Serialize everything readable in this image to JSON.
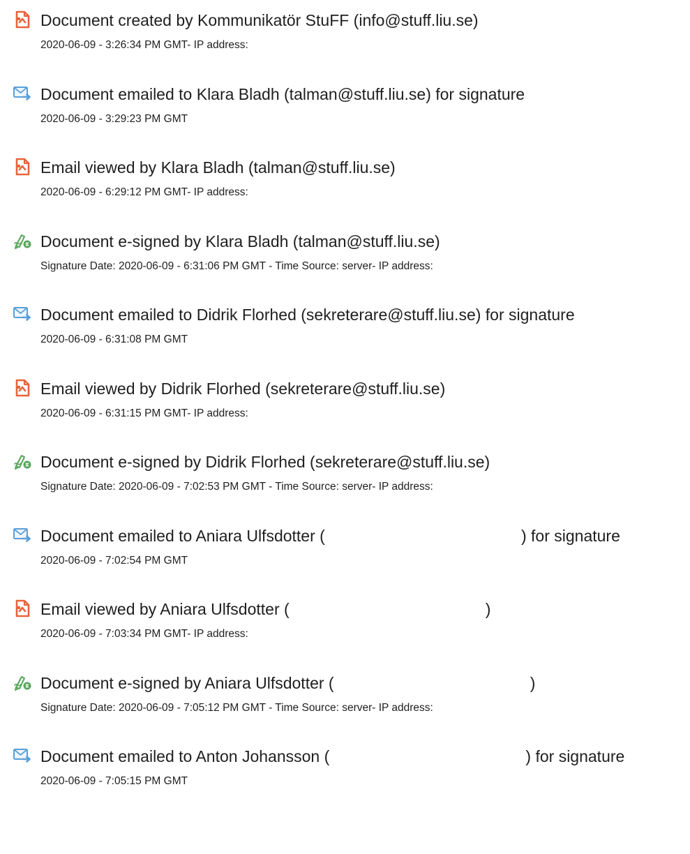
{
  "colors": {
    "doc_icon": "#e8643c",
    "mail_icon": "#5a9fd8",
    "sign_icon": "#58a55c",
    "text": "#1f1f1f"
  },
  "events": [
    {
      "icon": "document-icon",
      "title": "Document created by Kommunikatör StuFF (info@stuff.liu.se)",
      "detail": "2020-06-09 - 3:26:34 PM GMT- IP address:"
    },
    {
      "icon": "email-sent-icon",
      "title": "Document emailed to Klara Bladh (talman@stuff.liu.se) for signature",
      "detail": "2020-06-09 - 3:29:23 PM GMT"
    },
    {
      "icon": "document-icon",
      "title": "Email viewed by Klara Bladh (talman@stuff.liu.se)",
      "detail": "2020-06-09 - 6:29:12 PM GMT- IP address:"
    },
    {
      "icon": "esign-pen-icon",
      "title": "Document e-signed by Klara Bladh (talman@stuff.liu.se)",
      "detail": "Signature Date: 2020-06-09 - 6:31:06 PM GMT - Time Source: server- IP address:"
    },
    {
      "icon": "email-sent-icon",
      "title": "Document emailed to Didrik Florhed (sekreterare@stuff.liu.se) for signature",
      "detail": "2020-06-09 - 6:31:08 PM GMT"
    },
    {
      "icon": "document-icon",
      "title": "Email viewed by Didrik Florhed (sekreterare@stuff.liu.se)",
      "detail": "2020-06-09 - 6:31:15 PM GMT- IP address:"
    },
    {
      "icon": "esign-pen-icon",
      "title": "Document e-signed by Didrik Florhed (sekreterare@stuff.liu.se)",
      "detail": "Signature Date: 2020-06-09 - 7:02:53 PM GMT - Time Source: server- IP address:"
    },
    {
      "icon": "email-sent-icon",
      "title": "Document emailed to Aniara Ulfsdotter (                                            ) for signature",
      "detail": "2020-06-09 - 7:02:54 PM GMT"
    },
    {
      "icon": "document-icon",
      "title": "Email viewed by Aniara Ulfsdotter (                                            )",
      "detail": "2020-06-09 - 7:03:34 PM GMT- IP address:"
    },
    {
      "icon": "esign-pen-icon",
      "title": "Document e-signed by Aniara Ulfsdotter (                                            )",
      "detail": "Signature Date: 2020-06-09 - 7:05:12 PM GMT - Time Source: server- IP address:"
    },
    {
      "icon": "email-sent-icon",
      "title": "Document emailed to Anton Johansson (                                            ) for signature",
      "detail": "2020-06-09 - 7:05:15 PM GMT"
    }
  ]
}
